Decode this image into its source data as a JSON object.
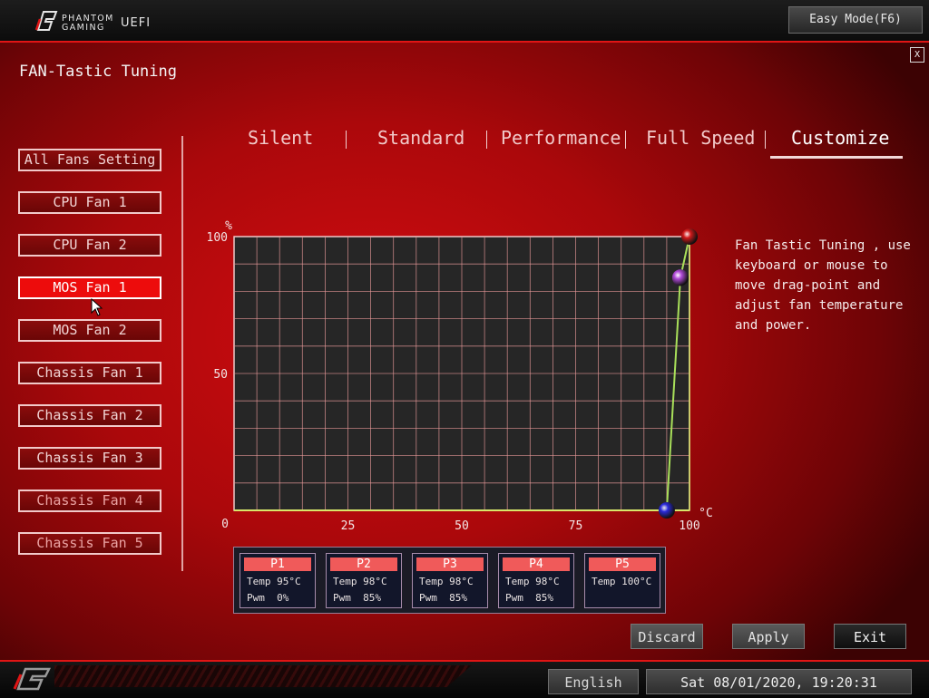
{
  "header": {
    "brand_line1": "PHANTOM",
    "brand_line2": "GAMING",
    "brand_uefi": "UEFI",
    "easy_mode_label": "Easy Mode(F6)",
    "close_label": "X"
  },
  "page_title": "FAN-Tastic Tuning",
  "fans": [
    {
      "label": "All Fans Setting"
    },
    {
      "label": "CPU Fan 1"
    },
    {
      "label": "CPU Fan 2"
    },
    {
      "label": "MOS Fan 1",
      "selected": true
    },
    {
      "label": "MOS Fan 2"
    },
    {
      "label": "Chassis Fan 1"
    },
    {
      "label": "Chassis Fan 2"
    },
    {
      "label": "Chassis Fan 3"
    },
    {
      "label": "Chassis Fan 4"
    },
    {
      "label": "Chassis Fan 5"
    }
  ],
  "modes": [
    {
      "label": "Silent"
    },
    {
      "label": "Standard"
    },
    {
      "label": "Performance"
    },
    {
      "label": "Full Speed"
    },
    {
      "label": "Customize",
      "selected": true
    }
  ],
  "help_text": "Fan Tastic Tuning , use keyboard or mouse to move drag-point and adjust fan temperature and power.",
  "chart_data": {
    "type": "line",
    "title": "",
    "xlabel": "°C",
    "ylabel": "%",
    "xlim": [
      0,
      100
    ],
    "ylim": [
      0,
      100
    ],
    "x_ticks": [
      "0",
      "25",
      "50",
      "75",
      "100"
    ],
    "y_ticks": [
      "0",
      "50",
      "100"
    ],
    "grid": true,
    "series": [
      {
        "x": [
          95,
          98,
          98,
          98,
          100
        ],
        "y": [
          0,
          85,
          85,
          85,
          100
        ]
      }
    ],
    "handle_colors": [
      "#2b2bdc",
      "#b04ad8",
      "#b04ad8",
      "#b04ad8",
      "#d21a1a"
    ],
    "line_color": "#a9e05a",
    "grid_color": "#e99a9a"
  },
  "points": [
    {
      "label": "P1",
      "temp": "Temp 95°C",
      "pwm": "Pwm  0%"
    },
    {
      "label": "P2",
      "temp": "Temp 98°C",
      "pwm": "Pwm  85%"
    },
    {
      "label": "P3",
      "temp": "Temp 98°C",
      "pwm": "Pwm  85%"
    },
    {
      "label": "P4",
      "temp": "Temp 98°C",
      "pwm": "Pwm  85%"
    },
    {
      "label": "P5",
      "temp": "Temp 100°C",
      "pwm": ""
    }
  ],
  "buttons": {
    "discard": "Discard",
    "apply": "Apply",
    "exit": "Exit"
  },
  "footer": {
    "language": "English",
    "datetime": "Sat 08/01/2020, 19:20:31"
  }
}
